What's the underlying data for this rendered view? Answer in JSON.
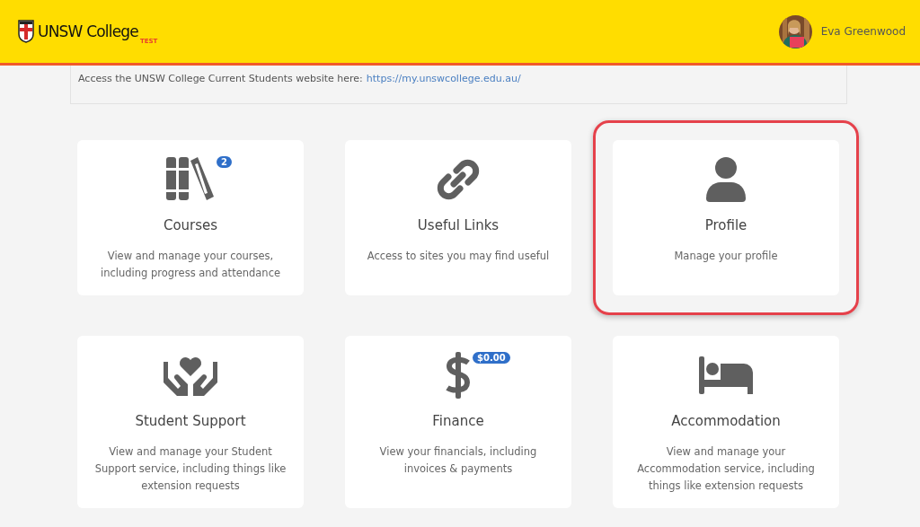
{
  "header": {
    "logo_text": "UNSW College",
    "logo_tag": "TEST",
    "user_name": "Eva Greenwood"
  },
  "notice": {
    "text": "Access the UNSW College Current Students website here:",
    "link": "https://my.unswcollege.edu.au/"
  },
  "tiles": [
    {
      "kind": "books",
      "title": "Courses",
      "description": "View and manage your courses, including progress and attendance",
      "badge": "2",
      "highlighted": false
    },
    {
      "kind": "link",
      "title": "Useful Links",
      "description": "Access to sites you may find useful",
      "highlighted": false
    },
    {
      "kind": "person",
      "title": "Profile",
      "description": "Manage your profile",
      "highlighted": true
    },
    {
      "kind": "heart-hands",
      "title": "Student Support",
      "description": "View and manage your Student Support service, including things like extension requests",
      "highlighted": false
    },
    {
      "kind": "dollar",
      "title": "Finance",
      "description": "View your financials, including invoices & payments",
      "badge": "$0.00",
      "highlighted": false
    },
    {
      "kind": "bed",
      "title": "Accommodation",
      "description": "View and manage your Accommodation service, including things like extension requests",
      "highlighted": false
    }
  ]
}
